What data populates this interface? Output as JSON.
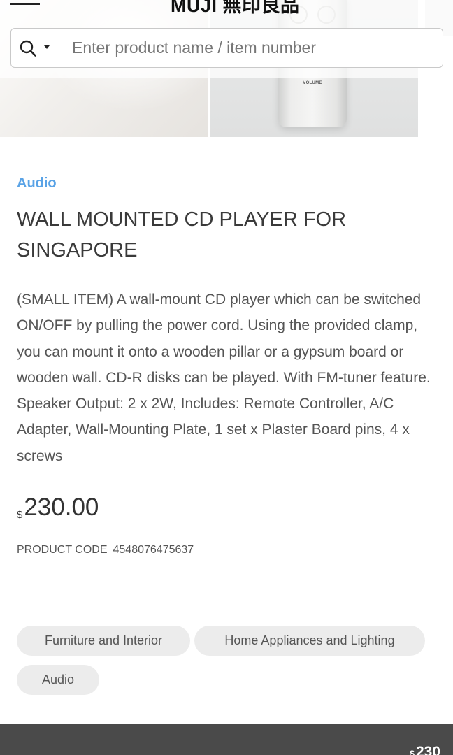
{
  "header": {
    "logo_text": "MUJI 無印良品",
    "search": {
      "placeholder": "Enter product name / item number",
      "value": ""
    }
  },
  "hero": {
    "device_label": "VOLUME"
  },
  "product": {
    "category": "Audio",
    "title": "WALL MOUNTED CD PLAYER FOR SINGAPORE",
    "description": "(SMALL ITEM) A wall-mount CD player which can be switched ON/OFF by pulling the power cord. Using the provided clamp, you can mount it onto a wooden pillar or a gypsum board or wooden wall. CD-R disks can be played. With FM-tuner feature. Speaker Output: 2 x 2W, Includes: Remote Controller, A/C Adapter, Wall-Mounting Plate, 1 set x Plaster Board pins, 4 x screws",
    "price_currency": "$",
    "price_amount": "230.00",
    "code_label": "PRODUCT CODE",
    "code_value": "4548076475637"
  },
  "tags": [
    "Furniture and Interior",
    "Home Appliances and Lighting",
    "Audio"
  ],
  "bottom_bar": {
    "price_currency": "$",
    "price_amount": "230"
  },
  "colors": {
    "accent_link": "#5aa3e6",
    "bottom_bar": "#4a4a4a",
    "chip_background": "#ececec"
  }
}
